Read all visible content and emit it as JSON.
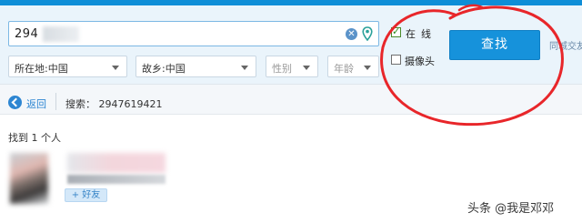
{
  "colors": {
    "topbar": "#0f8ed7",
    "panel": "#eaf4fb",
    "primary_button": "#1692db",
    "annotation_circle": "#e8262a",
    "link": "#2d86d2"
  },
  "search": {
    "value": "294",
    "clear_icon": "clear-x-icon",
    "location_icon": "map-pin-icon"
  },
  "filters": {
    "location": "所在地:中国",
    "hometown": "故乡:中国",
    "gender_placeholder": "性别",
    "age_placeholder": "年龄"
  },
  "options": {
    "online_label": "在线",
    "online_checked": true,
    "camera_label": "摄像头",
    "camera_checked": false
  },
  "find_button": "查找",
  "side_text": "同城交友",
  "nav": {
    "back_label": "返回",
    "breadcrumb": "搜索： 2947619421"
  },
  "results": {
    "count_text": "找到 1 个人",
    "items": [
      {
        "add_friend_label": "+ 好友"
      }
    ]
  },
  "watermark": {
    "prefix": "头条",
    "handle": "@我是邓邓"
  }
}
